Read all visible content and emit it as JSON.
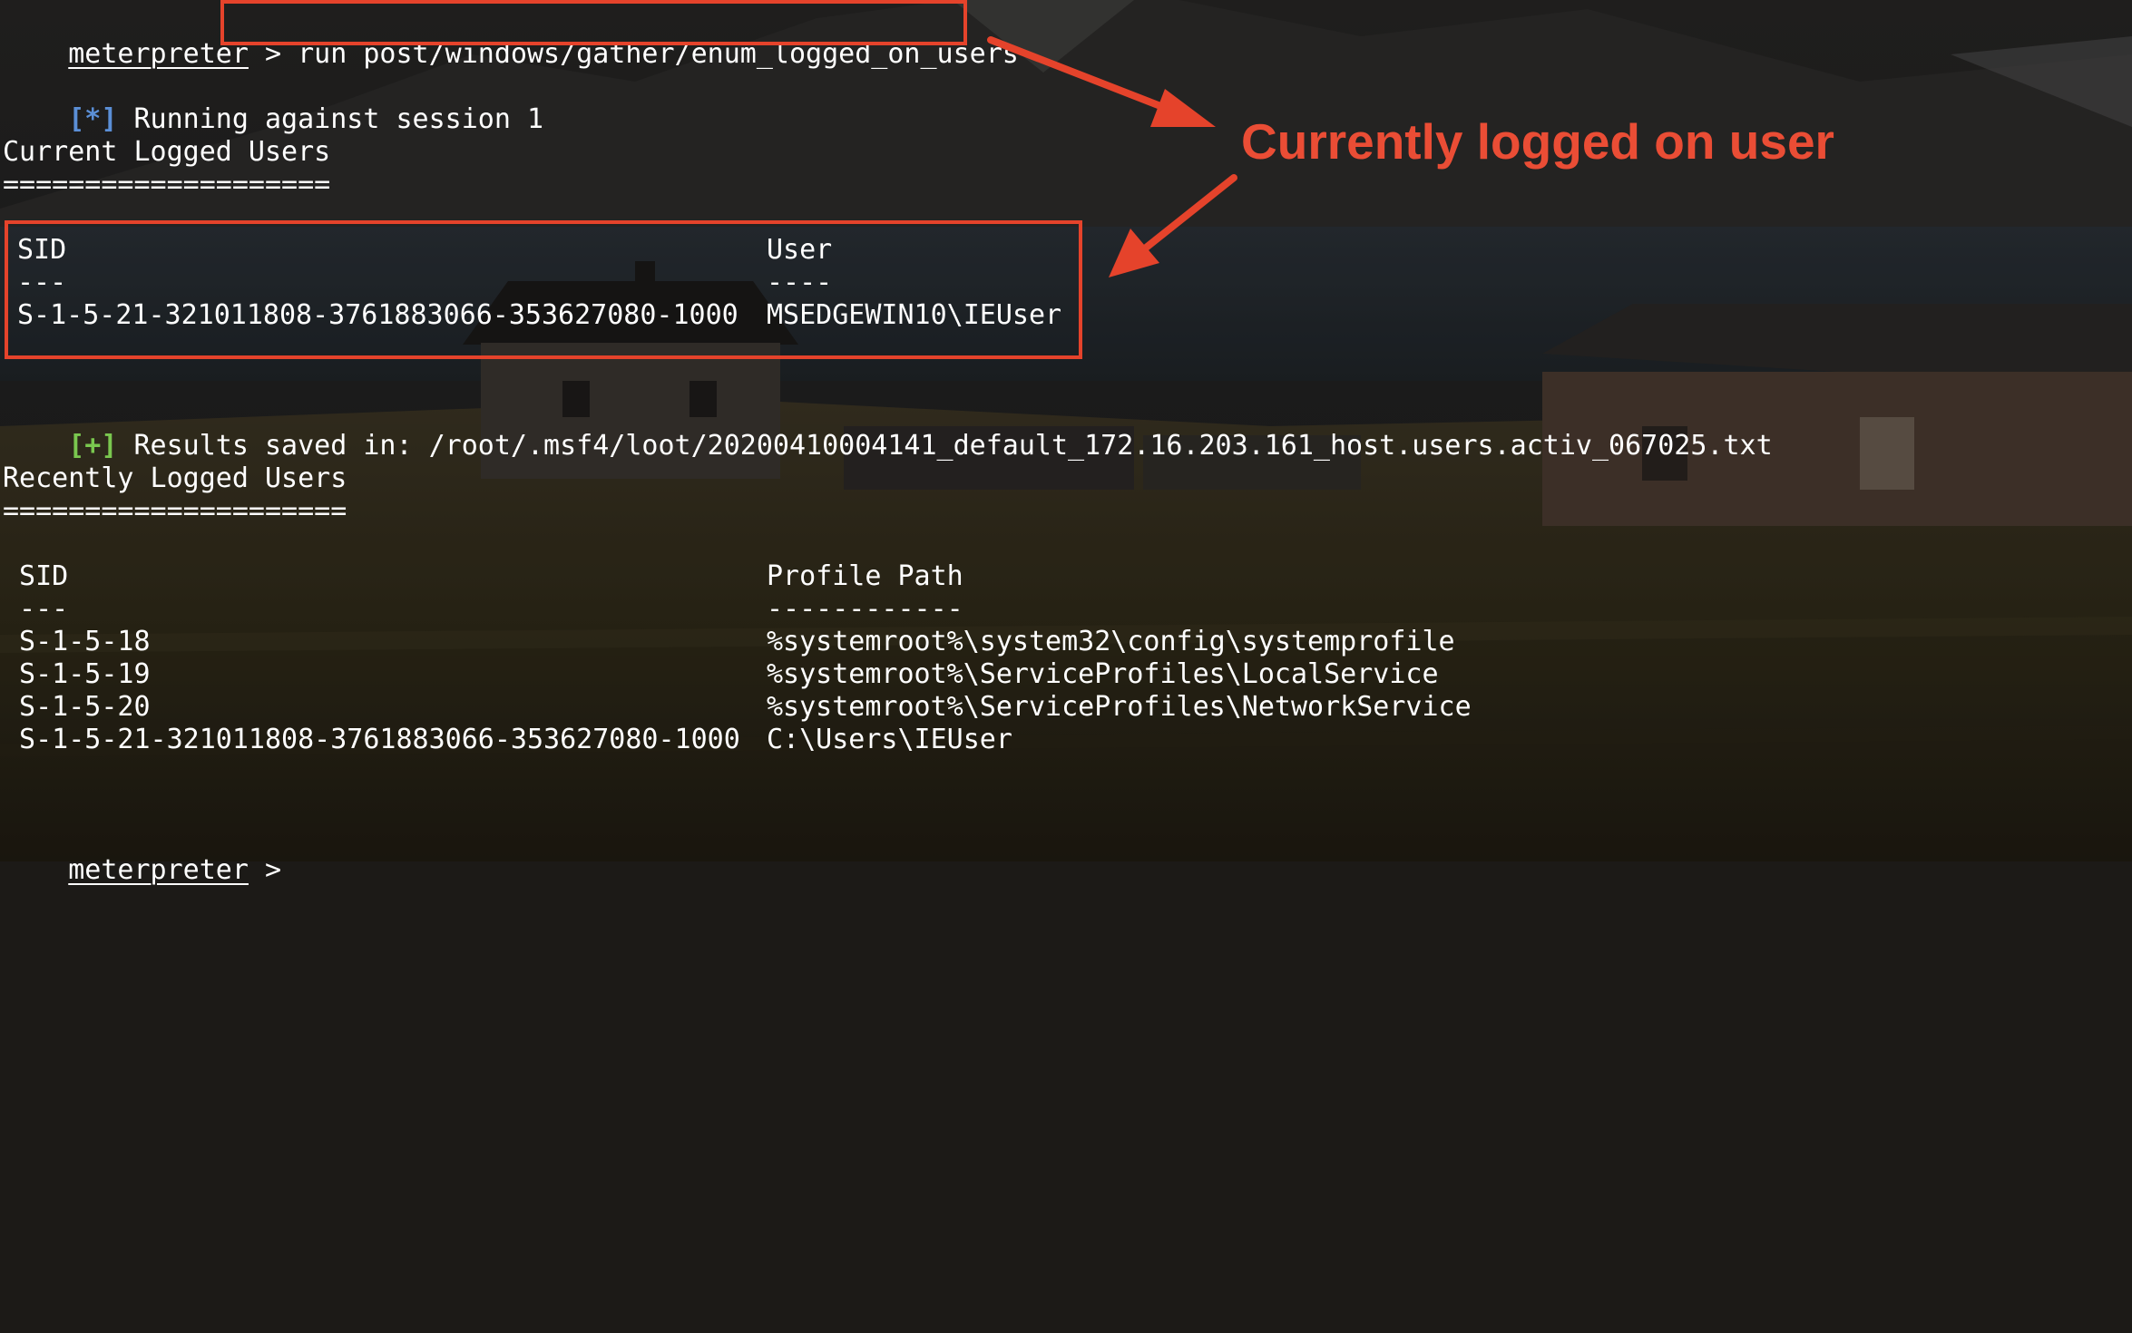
{
  "prompt": {
    "name": "meterpreter",
    "symbol": ">",
    "command": "run post/windows/gather/enum_logged_on_users"
  },
  "status_running": {
    "tag": "[*]",
    "text": "Running against session 1"
  },
  "current_section": {
    "title": "Current Logged Users",
    "underline": "====================",
    "headers": [
      "SID",
      "User"
    ],
    "dividers": [
      "---",
      "----"
    ],
    "rows": [
      {
        "sid": "S-1-5-21-321011808-3761883066-353627080-1000",
        "user": "MSEDGEWIN10\\IEUser"
      }
    ]
  },
  "status_saved": {
    "tag": "[+]",
    "text": "Results saved in: /root/.msf4/loot/20200410004141_default_172.16.203.161_host.users.activ_067025.txt"
  },
  "recent_section": {
    "title": "Recently Logged Users",
    "underline": "=====================",
    "headers": [
      " SID",
      "Profile Path"
    ],
    "dividers": [
      " ---",
      "------------"
    ],
    "rows": [
      {
        "sid": " S-1-5-18",
        "path": "%systemroot%\\system32\\config\\systemprofile"
      },
      {
        "sid": " S-1-5-19",
        "path": "%systemroot%\\ServiceProfiles\\LocalService"
      },
      {
        "sid": " S-1-5-20",
        "path": "%systemroot%\\ServiceProfiles\\NetworkService"
      },
      {
        "sid": " S-1-5-21-321011808-3761883066-353627080-1000",
        "path": "C:\\Users\\IEUser"
      }
    ]
  },
  "annotation": {
    "text": "Currently logged on user",
    "color": "#ea4d35"
  },
  "colors": {
    "highlight": "#e5432b",
    "info_tag": "#5b8fd6",
    "success_tag": "#7ac74f",
    "text": "#ffffff"
  }
}
